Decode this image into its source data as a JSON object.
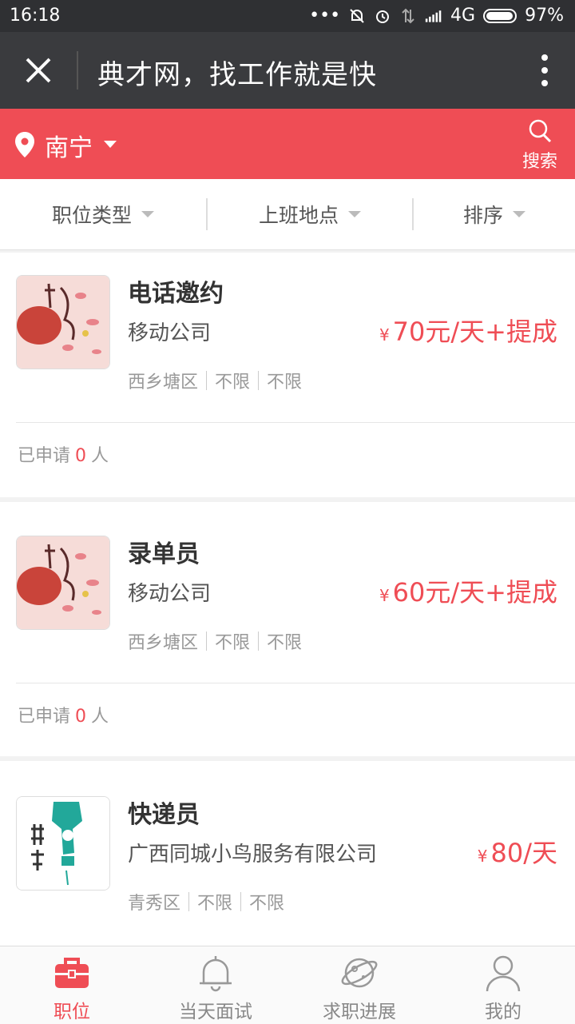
{
  "status_bar": {
    "time": "16:18",
    "network": "4G",
    "battery": "97%"
  },
  "title_bar": {
    "title": "典才网，找工作就是快"
  },
  "location_bar": {
    "city": "南宁",
    "search_label": "搜索"
  },
  "filters": [
    {
      "label": "职位类型"
    },
    {
      "label": "上班地点"
    },
    {
      "label": "排序"
    }
  ],
  "jobs": [
    {
      "title": "电话邀约",
      "company": "移动公司",
      "currency": "¥",
      "salary": "70元/天+提成",
      "tags": [
        "西乡塘区",
        "不限",
        "不限"
      ],
      "applied_prefix": "已申请",
      "applied_count": "0",
      "applied_suffix": "人"
    },
    {
      "title": "录单员",
      "company": "移动公司",
      "currency": "¥",
      "salary": "60元/天+提成",
      "tags": [
        "西乡塘区",
        "不限",
        "不限"
      ],
      "applied_prefix": "已申请",
      "applied_count": "0",
      "applied_suffix": "人"
    },
    {
      "title": "快递员",
      "company": "广西同城小鸟服务有限公司",
      "currency": "¥",
      "salary": "80/天",
      "tags": [
        "青秀区",
        "不限",
        "不限"
      ]
    }
  ],
  "tabs": [
    {
      "label": "职位",
      "icon": "briefcase-icon",
      "active": true
    },
    {
      "label": "当天面试",
      "icon": "bell-icon"
    },
    {
      "label": "求职进展",
      "icon": "planet-icon"
    },
    {
      "label": "我的",
      "icon": "user-icon"
    }
  ],
  "colors": {
    "accent": "#ef4d55",
    "title_bar": "#3a3b3e",
    "status_bar": "#2f3033"
  }
}
